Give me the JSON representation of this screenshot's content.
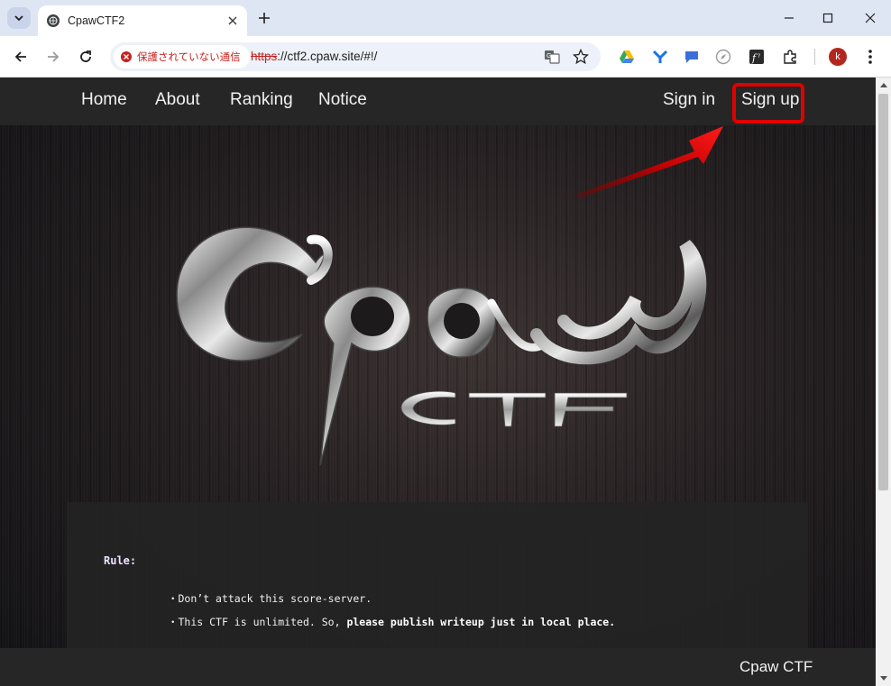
{
  "browser": {
    "tab_title": "CpawCTF2",
    "security_chip": "保護されていない通信",
    "url_scheme": "https",
    "url_rest": "://ctf2.cpaw.site/#!/",
    "profile_initial": "k"
  },
  "site": {
    "nav": {
      "home": "Home",
      "about": "About",
      "ranking": "Ranking",
      "notice": "Notice",
      "sign_in": "Sign in",
      "sign_up": "Sign up"
    },
    "rules": {
      "title": "Rule:",
      "item1": "・Don’t attack this score-server.",
      "item2_plain": "・This CTF is unlimited. So, ",
      "item2_bold": "please publish writeup just in local place."
    },
    "footer_brand": "Cpaw CTF"
  },
  "colors": {
    "highlight": "#e00000",
    "insecure": "#c5221f",
    "nav_bg": "#262626"
  }
}
